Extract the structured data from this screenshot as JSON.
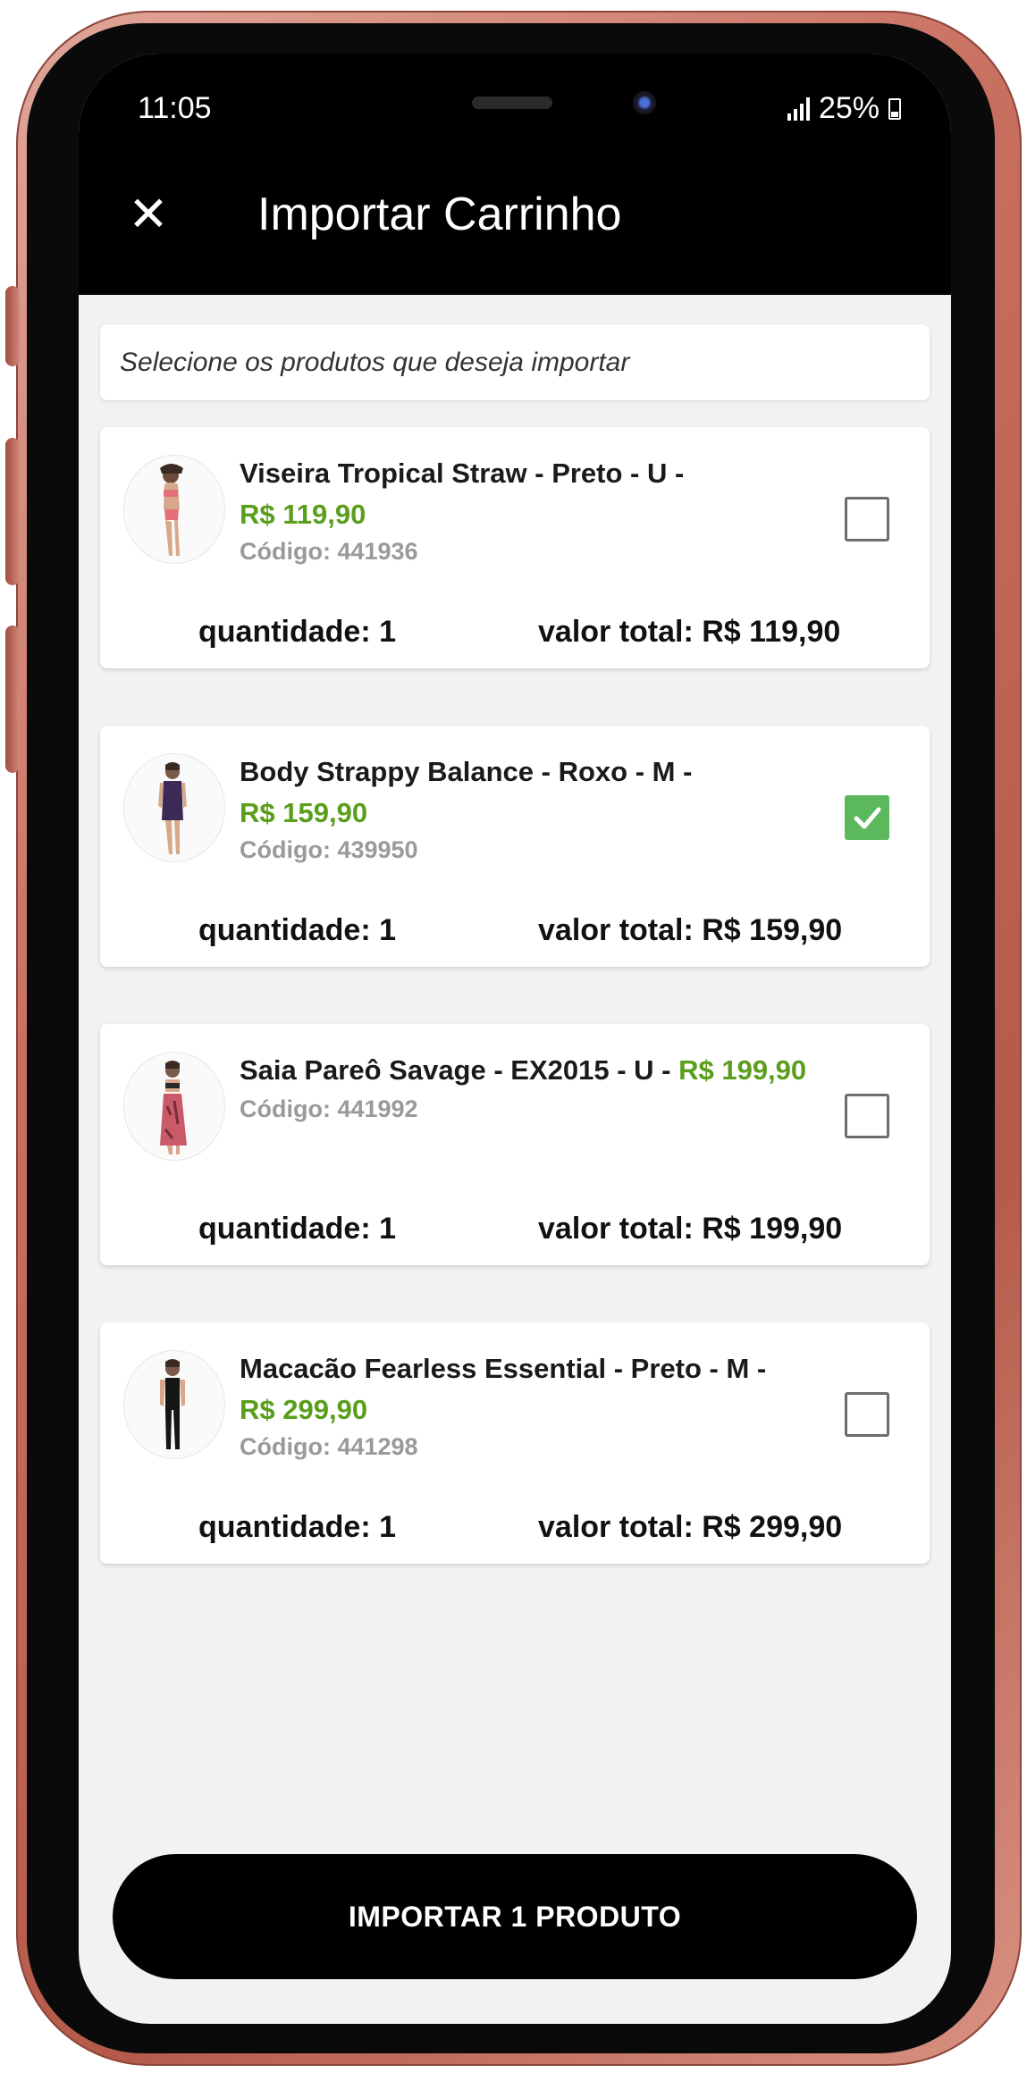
{
  "status_bar": {
    "time": "11:05",
    "battery": "25%"
  },
  "header": {
    "title": "Importar Carrinho",
    "close_icon": "close-icon"
  },
  "instruction": "Selecione os produtos que deseja importar",
  "labels": {
    "quantity_prefix": "quantidade:",
    "total_prefix": "valor total:"
  },
  "products": [
    {
      "name": "Viseira Tropical Straw - Preto - U -",
      "price": "R$ 119,90",
      "code": "Código: 441936",
      "quantity": "quantidade: 1",
      "total": "valor total: R$ 119,90",
      "checked": false
    },
    {
      "name": "Body Strappy Balance - Roxo - M -",
      "price": "R$ 159,90",
      "code": "Código: 439950",
      "quantity": "quantidade: 1",
      "total": "valor total: R$ 159,90",
      "checked": true
    },
    {
      "name": "Saia Pareô Savage - EX2015 - U -",
      "price": "R$ 199,90",
      "code": "Código: 441992",
      "quantity": "quantidade: 1",
      "total": "valor total: R$ 199,90",
      "checked": false
    },
    {
      "name": "Macacão Fearless Essential - Preto - M -",
      "price": "R$ 299,90",
      "code": "Código: 441298",
      "quantity": "quantidade: 1",
      "total": "valor total: R$ 299,90",
      "checked": false
    }
  ],
  "import_button": "IMPORTAR 1 PRODUTO",
  "colors": {
    "price_green": "#5a9e1c",
    "checkbox_green": "#5cb85c",
    "frame_rose_gold": "#c86f5f",
    "header_bg": "#000000"
  }
}
